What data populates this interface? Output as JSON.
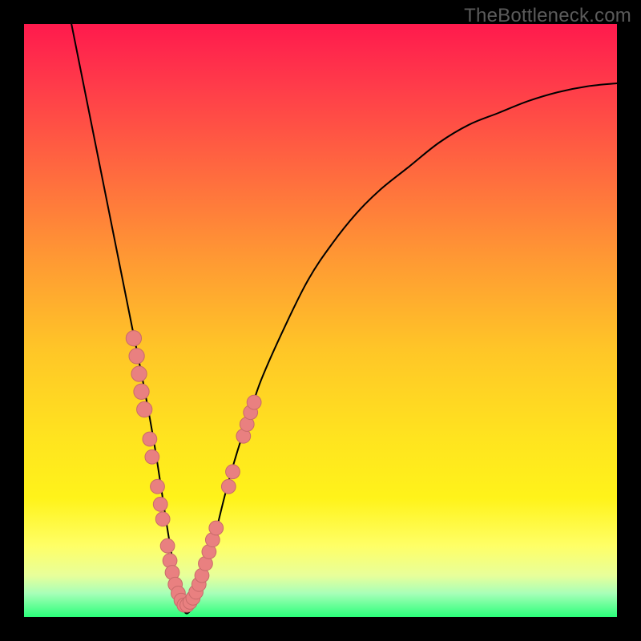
{
  "watermark": "TheBottleneck.com",
  "colors": {
    "frame": "#000000",
    "curve": "#000000",
    "marker_fill": "#e98080",
    "marker_stroke": "#c96a6a",
    "gradient_stops": [
      {
        "pos": 0.0,
        "color": "#ff1a4d"
      },
      {
        "pos": 0.1,
        "color": "#ff3a4a"
      },
      {
        "pos": 0.25,
        "color": "#ff6a3f"
      },
      {
        "pos": 0.4,
        "color": "#ff9a33"
      },
      {
        "pos": 0.55,
        "color": "#ffc627"
      },
      {
        "pos": 0.7,
        "color": "#ffe41f"
      },
      {
        "pos": 0.8,
        "color": "#fff31a"
      },
      {
        "pos": 0.88,
        "color": "#ffff66"
      },
      {
        "pos": 0.93,
        "color": "#e8ff9a"
      },
      {
        "pos": 0.96,
        "color": "#a8ffb8"
      },
      {
        "pos": 1.0,
        "color": "#2bff7a"
      }
    ]
  },
  "chart_data": {
    "type": "line",
    "title": "",
    "xlabel": "",
    "ylabel": "",
    "xlim": [
      0,
      100
    ],
    "ylim": [
      0,
      100
    ],
    "notes": "V-shaped bottleneck curve on a heat-gradient background. No axis ticks or numeric labels are rendered; values are normalized 0–100 in each axis. Minimum of the curve is near x≈27, y≈0. Pink bead markers cluster along the lower portion of both arms.",
    "series": [
      {
        "name": "bottleneck-curve",
        "x": [
          8,
          10,
          12,
          14,
          16,
          18,
          20,
          22,
          24,
          25,
          26,
          27,
          28,
          29,
          30,
          32,
          34,
          36,
          38,
          40,
          44,
          48,
          52,
          56,
          60,
          65,
          70,
          75,
          80,
          85,
          90,
          95,
          100
        ],
        "y": [
          100,
          90,
          80,
          70,
          60,
          50,
          40,
          29,
          16,
          10,
          5,
          1,
          1,
          3,
          6,
          13,
          21,
          28,
          34,
          40,
          49,
          57,
          63,
          68,
          72,
          76,
          80,
          83,
          85,
          87,
          88.5,
          89.5,
          90
        ]
      }
    ],
    "markers": [
      {
        "x": 18.5,
        "y": 47,
        "r": 1.3
      },
      {
        "x": 19.0,
        "y": 44,
        "r": 1.3
      },
      {
        "x": 19.4,
        "y": 41,
        "r": 1.3
      },
      {
        "x": 19.8,
        "y": 38,
        "r": 1.3
      },
      {
        "x": 20.3,
        "y": 35,
        "r": 1.3
      },
      {
        "x": 21.2,
        "y": 30,
        "r": 1.2
      },
      {
        "x": 21.6,
        "y": 27,
        "r": 1.2
      },
      {
        "x": 22.5,
        "y": 22,
        "r": 1.2
      },
      {
        "x": 23.0,
        "y": 19,
        "r": 1.2
      },
      {
        "x": 23.4,
        "y": 16.5,
        "r": 1.2
      },
      {
        "x": 24.2,
        "y": 12,
        "r": 1.2
      },
      {
        "x": 24.6,
        "y": 9.5,
        "r": 1.2
      },
      {
        "x": 25.0,
        "y": 7.5,
        "r": 1.2
      },
      {
        "x": 25.5,
        "y": 5.5,
        "r": 1.2
      },
      {
        "x": 26.0,
        "y": 4.0,
        "r": 1.2
      },
      {
        "x": 26.5,
        "y": 2.8,
        "r": 1.2
      },
      {
        "x": 27.0,
        "y": 2.0,
        "r": 1.2
      },
      {
        "x": 27.5,
        "y": 2.0,
        "r": 1.2
      },
      {
        "x": 28.0,
        "y": 2.5,
        "r": 1.2
      },
      {
        "x": 28.5,
        "y": 3.2,
        "r": 1.2
      },
      {
        "x": 29.0,
        "y": 4.2,
        "r": 1.2
      },
      {
        "x": 29.5,
        "y": 5.5,
        "r": 1.2
      },
      {
        "x": 30.0,
        "y": 7.0,
        "r": 1.2
      },
      {
        "x": 30.6,
        "y": 9.0,
        "r": 1.2
      },
      {
        "x": 31.2,
        "y": 11.0,
        "r": 1.2
      },
      {
        "x": 31.8,
        "y": 13.0,
        "r": 1.2
      },
      {
        "x": 32.4,
        "y": 15.0,
        "r": 1.2
      },
      {
        "x": 34.5,
        "y": 22.0,
        "r": 1.2
      },
      {
        "x": 35.2,
        "y": 24.5,
        "r": 1.2
      },
      {
        "x": 37.0,
        "y": 30.5,
        "r": 1.2
      },
      {
        "x": 37.6,
        "y": 32.5,
        "r": 1.2
      },
      {
        "x": 38.2,
        "y": 34.5,
        "r": 1.2
      },
      {
        "x": 38.8,
        "y": 36.2,
        "r": 1.2
      }
    ]
  }
}
